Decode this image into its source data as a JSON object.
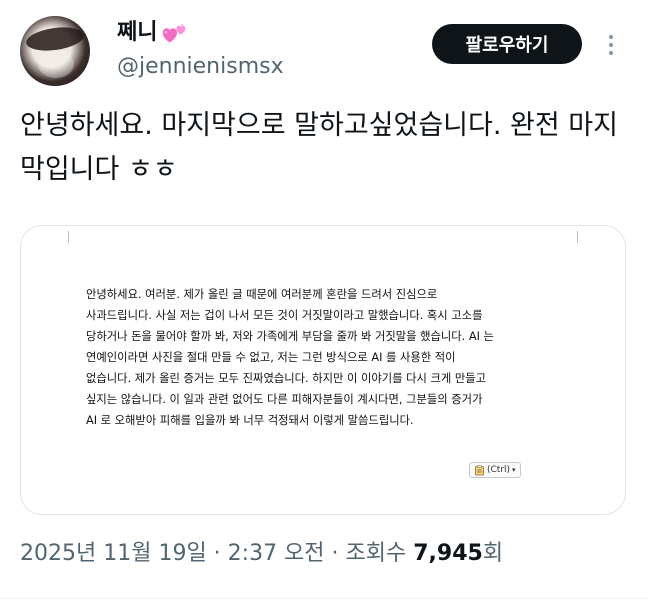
{
  "author": {
    "display_name": "쩨니",
    "handle": "@jennienismsx",
    "name_emoji": "two-hearts-icon"
  },
  "actions": {
    "follow_label": "팔로우하기",
    "more_icon": "more-vertical-icon"
  },
  "tweet": {
    "text": "안녕하세요. 마지막으로 말하고싶었습니다. 완전 마지막입니다 ㅎㅎ"
  },
  "media": {
    "document_lines": [
      "안녕하세요. 여러분. 제가 올린 글 때문에 여러분께 혼란을 드려서 진심으로",
      "사과드립니다. 사실 저는 겁이 나서 모든 것이 거짓말이라고 말했습니다. 혹시 고소를",
      "당하거나 돈을 물어야 할까 봐, 저와 가족에게 부담을 줄까 봐 거짓말을 했습니다. AI 는",
      "연예인이라면 사진을 절대 만들 수 없고, 저는 그런 방식으로 AI 를 사용한 적이",
      "없습니다. 제가 올린 증거는 모두 진짜였습니다. 하지만 이 이야기를 다시 크게 만들고",
      "싶지는 않습니다. 이 일과 관련 없어도 다른 피해자분들이 계시다면, 그분들의 증거가",
      "AI 로 오해받아 피해를 입을까 봐 너무 걱정돼서 이렇게 말씀드립니다."
    ],
    "paste_option_label": "(Ctrl)",
    "paste_icon": "clipboard-icon",
    "chevron_icon": "chevron-down-icon"
  },
  "meta": {
    "date_time": "2025년 11월 19일 · 2:37 오전 · 조회수 ",
    "view_count": "7,945",
    "view_unit": "회"
  },
  "colors": {
    "text": "#0f1419",
    "secondary": "#536471",
    "button_bg": "#0f1419",
    "border": "#dfe3e8"
  }
}
